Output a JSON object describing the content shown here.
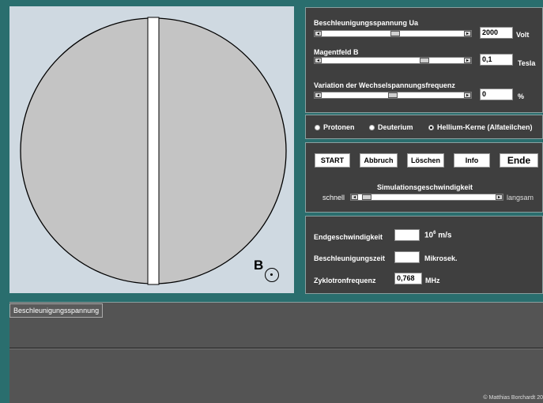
{
  "sliders": {
    "voltage": {
      "label": "Beschleunigungsspannung Ua",
      "value": "2000",
      "unit": "Volt",
      "level": 0.52
    },
    "field": {
      "label": "Magentfeld B",
      "value": "0,1",
      "unit": "Tesla",
      "level": 0.74
    },
    "freq": {
      "label": "Variation der Wechselspannungsfrequenz",
      "value": "0",
      "unit": "%",
      "level": 0.5
    }
  },
  "particles": {
    "options": [
      {
        "label": "Protonen",
        "selected": false
      },
      {
        "label": "Deuterium",
        "selected": false
      },
      {
        "label": "Hellium-Kerne (Alfateilchen)",
        "selected": true
      }
    ]
  },
  "controls": {
    "start": "START",
    "abort": "Abbruch",
    "clear": "Löschen",
    "info": "Info",
    "end": "Ende",
    "speed_label": "Simulationsgeschwindigkeit",
    "speed_fast": "schnell",
    "speed_slow": "langsam",
    "speed_level": 0.03
  },
  "results": {
    "end_velocity_label": "Endgeschwindigkeit",
    "end_velocity_value": "",
    "end_velocity_unit_base": "10",
    "end_velocity_unit_exp": "6",
    "end_velocity_unit_tail": "m/s",
    "accel_time_label": "Beschleunigungszeit",
    "accel_time_value": "",
    "accel_time_unit": "Mikrosek.",
    "cyclotron_freq_label": "Zyklotronfrequenz",
    "cyclotron_freq_value": "0,768",
    "cyclotron_freq_unit": "MHz"
  },
  "simulation": {
    "b_label": "B"
  },
  "scope": {
    "tab_label": "Beschleunigungsspannung"
  },
  "footer": {
    "copyright": "© Matthias Borchardt 20"
  },
  "colors": {
    "background": "#2a6e6e",
    "panel": "#3f3f3f",
    "dee": "#c4c4c4",
    "sim_bg": "#cfd9e1"
  }
}
